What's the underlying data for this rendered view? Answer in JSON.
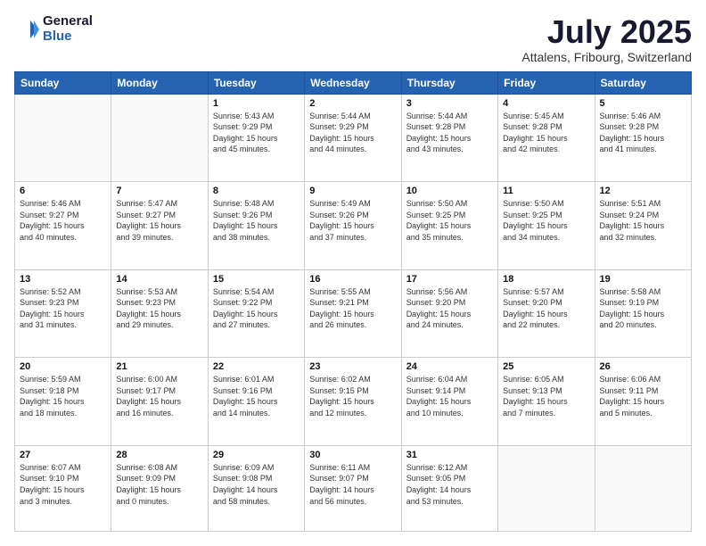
{
  "logo": {
    "general": "General",
    "blue": "Blue"
  },
  "title": "July 2025",
  "location": "Attalens, Fribourg, Switzerland",
  "days_of_week": [
    "Sunday",
    "Monday",
    "Tuesday",
    "Wednesday",
    "Thursday",
    "Friday",
    "Saturday"
  ],
  "weeks": [
    [
      {
        "day": "",
        "info": ""
      },
      {
        "day": "",
        "info": ""
      },
      {
        "day": "1",
        "info": "Sunrise: 5:43 AM\nSunset: 9:29 PM\nDaylight: 15 hours\nand 45 minutes."
      },
      {
        "day": "2",
        "info": "Sunrise: 5:44 AM\nSunset: 9:29 PM\nDaylight: 15 hours\nand 44 minutes."
      },
      {
        "day": "3",
        "info": "Sunrise: 5:44 AM\nSunset: 9:28 PM\nDaylight: 15 hours\nand 43 minutes."
      },
      {
        "day": "4",
        "info": "Sunrise: 5:45 AM\nSunset: 9:28 PM\nDaylight: 15 hours\nand 42 minutes."
      },
      {
        "day": "5",
        "info": "Sunrise: 5:46 AM\nSunset: 9:28 PM\nDaylight: 15 hours\nand 41 minutes."
      }
    ],
    [
      {
        "day": "6",
        "info": "Sunrise: 5:46 AM\nSunset: 9:27 PM\nDaylight: 15 hours\nand 40 minutes."
      },
      {
        "day": "7",
        "info": "Sunrise: 5:47 AM\nSunset: 9:27 PM\nDaylight: 15 hours\nand 39 minutes."
      },
      {
        "day": "8",
        "info": "Sunrise: 5:48 AM\nSunset: 9:26 PM\nDaylight: 15 hours\nand 38 minutes."
      },
      {
        "day": "9",
        "info": "Sunrise: 5:49 AM\nSunset: 9:26 PM\nDaylight: 15 hours\nand 37 minutes."
      },
      {
        "day": "10",
        "info": "Sunrise: 5:50 AM\nSunset: 9:25 PM\nDaylight: 15 hours\nand 35 minutes."
      },
      {
        "day": "11",
        "info": "Sunrise: 5:50 AM\nSunset: 9:25 PM\nDaylight: 15 hours\nand 34 minutes."
      },
      {
        "day": "12",
        "info": "Sunrise: 5:51 AM\nSunset: 9:24 PM\nDaylight: 15 hours\nand 32 minutes."
      }
    ],
    [
      {
        "day": "13",
        "info": "Sunrise: 5:52 AM\nSunset: 9:23 PM\nDaylight: 15 hours\nand 31 minutes."
      },
      {
        "day": "14",
        "info": "Sunrise: 5:53 AM\nSunset: 9:23 PM\nDaylight: 15 hours\nand 29 minutes."
      },
      {
        "day": "15",
        "info": "Sunrise: 5:54 AM\nSunset: 9:22 PM\nDaylight: 15 hours\nand 27 minutes."
      },
      {
        "day": "16",
        "info": "Sunrise: 5:55 AM\nSunset: 9:21 PM\nDaylight: 15 hours\nand 26 minutes."
      },
      {
        "day": "17",
        "info": "Sunrise: 5:56 AM\nSunset: 9:20 PM\nDaylight: 15 hours\nand 24 minutes."
      },
      {
        "day": "18",
        "info": "Sunrise: 5:57 AM\nSunset: 9:20 PM\nDaylight: 15 hours\nand 22 minutes."
      },
      {
        "day": "19",
        "info": "Sunrise: 5:58 AM\nSunset: 9:19 PM\nDaylight: 15 hours\nand 20 minutes."
      }
    ],
    [
      {
        "day": "20",
        "info": "Sunrise: 5:59 AM\nSunset: 9:18 PM\nDaylight: 15 hours\nand 18 minutes."
      },
      {
        "day": "21",
        "info": "Sunrise: 6:00 AM\nSunset: 9:17 PM\nDaylight: 15 hours\nand 16 minutes."
      },
      {
        "day": "22",
        "info": "Sunrise: 6:01 AM\nSunset: 9:16 PM\nDaylight: 15 hours\nand 14 minutes."
      },
      {
        "day": "23",
        "info": "Sunrise: 6:02 AM\nSunset: 9:15 PM\nDaylight: 15 hours\nand 12 minutes."
      },
      {
        "day": "24",
        "info": "Sunrise: 6:04 AM\nSunset: 9:14 PM\nDaylight: 15 hours\nand 10 minutes."
      },
      {
        "day": "25",
        "info": "Sunrise: 6:05 AM\nSunset: 9:13 PM\nDaylight: 15 hours\nand 7 minutes."
      },
      {
        "day": "26",
        "info": "Sunrise: 6:06 AM\nSunset: 9:11 PM\nDaylight: 15 hours\nand 5 minutes."
      }
    ],
    [
      {
        "day": "27",
        "info": "Sunrise: 6:07 AM\nSunset: 9:10 PM\nDaylight: 15 hours\nand 3 minutes."
      },
      {
        "day": "28",
        "info": "Sunrise: 6:08 AM\nSunset: 9:09 PM\nDaylight: 15 hours\nand 0 minutes."
      },
      {
        "day": "29",
        "info": "Sunrise: 6:09 AM\nSunset: 9:08 PM\nDaylight: 14 hours\nand 58 minutes."
      },
      {
        "day": "30",
        "info": "Sunrise: 6:11 AM\nSunset: 9:07 PM\nDaylight: 14 hours\nand 56 minutes."
      },
      {
        "day": "31",
        "info": "Sunrise: 6:12 AM\nSunset: 9:05 PM\nDaylight: 14 hours\nand 53 minutes."
      },
      {
        "day": "",
        "info": ""
      },
      {
        "day": "",
        "info": ""
      }
    ]
  ]
}
